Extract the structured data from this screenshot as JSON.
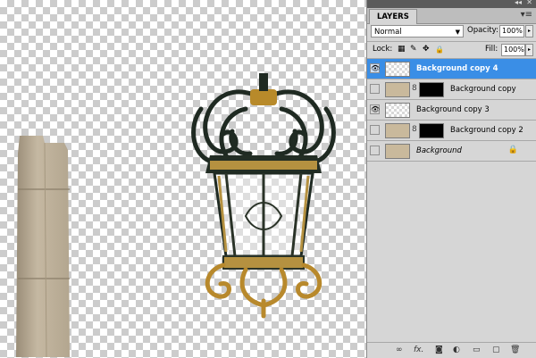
{
  "panel": {
    "collapse_glyph": "◂◂",
    "close_glyph": "✕",
    "tab_label": "LAYERS",
    "menu_glyph": "▾≡",
    "blend_mode": "Normal",
    "blend_arrow": "▼",
    "opacity_label": "Opacity:",
    "opacity_value": "100%",
    "lock_label": "Lock:",
    "fill_label": "Fill:",
    "fill_value": "100%",
    "num_arrow": "▸"
  },
  "lock_icons": {
    "transparent": "▦",
    "image": "✎",
    "position": "✥",
    "all": "🔒"
  },
  "layers": [
    {
      "name": "Background copy 4",
      "visible": true,
      "selected": true,
      "has_mask": false,
      "italic": false
    },
    {
      "name": "Background copy",
      "visible": false,
      "selected": false,
      "has_mask": true,
      "italic": false
    },
    {
      "name": "Background copy 3",
      "visible": true,
      "selected": false,
      "has_mask": false,
      "italic": false
    },
    {
      "name": "Background copy 2",
      "visible": false,
      "selected": false,
      "has_mask": true,
      "italic": false
    },
    {
      "name": "Background",
      "visible": false,
      "selected": false,
      "has_mask": false,
      "italic": true,
      "locked": true
    }
  ],
  "layer_glyphs": {
    "eye": "👁",
    "chain": "8",
    "lock": "🔒"
  },
  "bottom_icons": {
    "link": "∞",
    "fx": "fx.",
    "mask": "◙",
    "adjustment": "◐",
    "group": "▭",
    "new": "▢",
    "delete": "🗑"
  },
  "colors": {
    "selection": "#3a8ee6",
    "panel_bg": "#d6d6d6"
  }
}
